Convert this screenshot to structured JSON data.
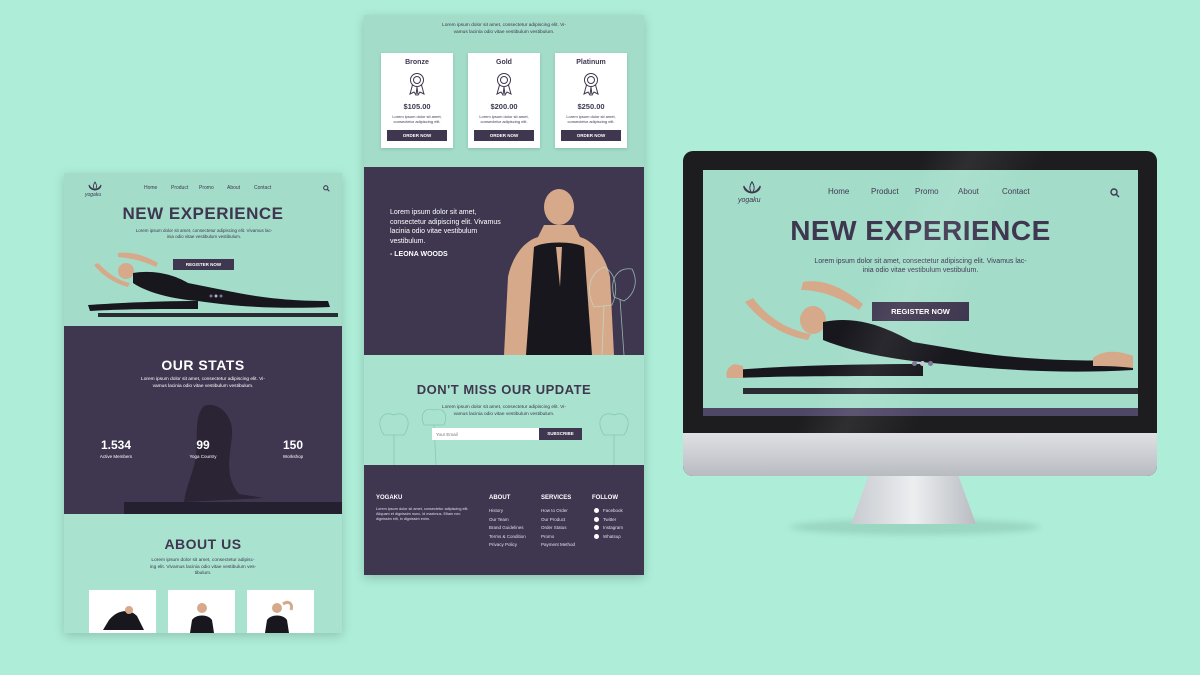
{
  "brand": {
    "name": "yogaku"
  },
  "nav": {
    "items": [
      "Home",
      "Product",
      "Promo",
      "About",
      "Contact"
    ]
  },
  "hero": {
    "title": "NEW EXPERIENCE",
    "desc_line1": "Lorem ipsum dolor sit amet, consectetur adipiscing elit. Vivamus lac-",
    "desc_line2": "inia odio vitae vestibulum vestibulum.",
    "register": "REGISTER NOW",
    "slide_active": 1,
    "slide_count": 3
  },
  "stats": {
    "title": "OUR STATS",
    "desc_line1": "Lorem ipsum dolor sit amet, consectetur adipiscing elit. Vi-",
    "desc_line2": "vamus lacinia odio vitae vestibulum vestibulum.",
    "items": [
      {
        "value": "1.534",
        "label": "Active Members"
      },
      {
        "value": "99",
        "label": "Yoga Country"
      },
      {
        "value": "150",
        "label": "Workshop"
      }
    ]
  },
  "about": {
    "title": "ABOUT US",
    "desc_line1": "Lorem ipsum dolor sit amet, consectetur adipisc-",
    "desc_line2": "ing elit. Vivamus lacinia odio vitae vestibulum ves-",
    "desc_line3": "tibulum."
  },
  "pricing": {
    "intro_line1": "Lorem ipsum dolor sit amet, consectetur adipiscing elit. Vi-",
    "intro_line2": "vamus lacinia odio vitae vestibulum vestibulum.",
    "plans": [
      {
        "name": "Bronze",
        "price": "$105.00",
        "desc": "Lorem ipsum dolor sit amet, consectetur adipiscing elit.",
        "cta": "ORDER NOW"
      },
      {
        "name": "Gold",
        "price": "$200.00",
        "desc": "Lorem ipsum dolor sit amet, consectetur adipiscing elit.",
        "cta": "ORDER NOW"
      },
      {
        "name": "Platinum",
        "price": "$250.00",
        "desc": "Lorem ipsum dolor sit amet, consectetur adipiscing elit.",
        "cta": "ORDER NOW"
      }
    ]
  },
  "testimonial": {
    "line1": "Lorem ipsum dolor sit amet,",
    "line2": "consectetur adipiscing elit. Vivamus",
    "line3": "lacinia odio vitae vestibulum",
    "line4": "vestibulum.",
    "author": "- LEONA WOODS"
  },
  "newsletter": {
    "title": "DON'T MISS OUR UPDATE",
    "desc_line1": "Lorem ipsum dolor sit amet, consectetur adipiscing elit. Vi-",
    "desc_line2": "vamus lacinia odio vitae vestibulum vestibulum.",
    "email_placeholder": "Your Email",
    "subscribe": "SUBSCRIBE"
  },
  "footer": {
    "brand": "YOGAKU",
    "brand_desc": "Lorem ipsum dolor sit amet, consectetur adipiscing elit. Aliquam et dignissim nunc, id maximus. Etiam nec dignissim elit, in dignissim enim.",
    "about_title": "ABOUT",
    "about_links": [
      "History",
      "Our Team",
      "Brand Guidelines",
      "Terms & Condition",
      "Privacy Policy"
    ],
    "services_title": "SERVICES",
    "services_links": [
      "How to Order",
      "Our Product",
      "Order Status",
      "Promo",
      "Payment Method"
    ],
    "follow_title": "FOLLOW",
    "follow_links": [
      "Facebook",
      "Twitter",
      "Instagram",
      "Whatsup"
    ]
  },
  "colors": {
    "background": "#aeeed8",
    "dark": "#3f3750",
    "mint": "#a3dcc9",
    "accent": "#4f4766"
  },
  "icons": {
    "search": "search-icon",
    "logo": "lotus-icon",
    "award": "award-ribbon-icon"
  }
}
